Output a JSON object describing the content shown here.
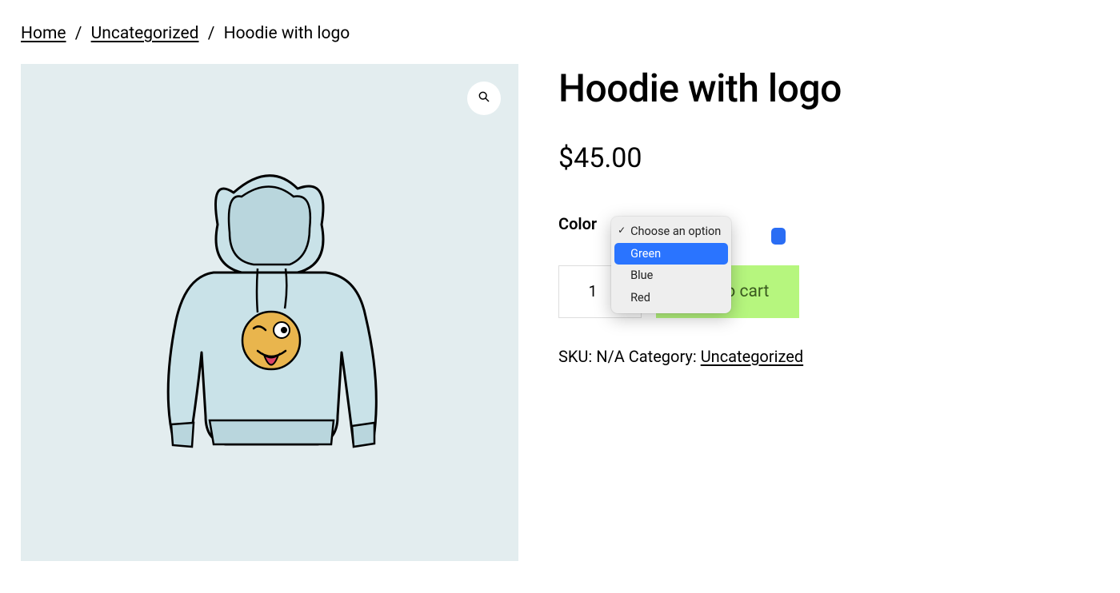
{
  "breadcrumb": {
    "home": "Home",
    "category": "Uncategorized",
    "current": "Hoodie with logo"
  },
  "product": {
    "title": "Hoodie with logo",
    "price": "$45.00",
    "variant_label": "Color",
    "options": {
      "placeholder": "Choose an option",
      "items": [
        "Green",
        "Blue",
        "Red"
      ],
      "highlighted": "Green"
    },
    "qty": "1",
    "add_to_cart": "Add to cart",
    "sku_label": "SKU:",
    "sku_value": "N/A",
    "category_label": "Category:",
    "category_value": "Uncategorized"
  }
}
